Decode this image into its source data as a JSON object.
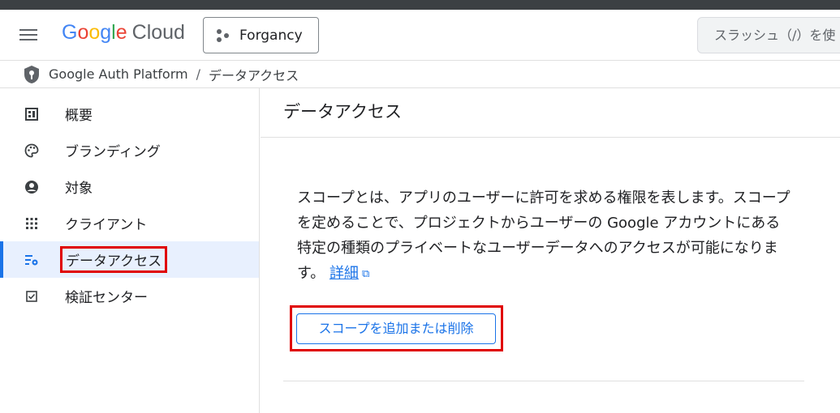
{
  "header": {
    "logo_google_letters": [
      "G",
      "o",
      "o",
      "g",
      "l",
      "e"
    ],
    "logo_cloud": "Cloud",
    "project_name": "Forgancy",
    "search_placeholder": "スラッシュ（/）を使"
  },
  "breadcrumb": {
    "root": "Google Auth Platform",
    "separator": "/",
    "current": "データアクセス"
  },
  "sidebar": {
    "items": [
      {
        "label": "概要",
        "icon": "dashboard-icon"
      },
      {
        "label": "ブランディング",
        "icon": "palette-icon"
      },
      {
        "label": "対象",
        "icon": "account-circle-icon"
      },
      {
        "label": "クライアント",
        "icon": "apps-grid-icon"
      },
      {
        "label": "データアクセス",
        "icon": "data-settings-icon",
        "active": true
      },
      {
        "label": "検証センター",
        "icon": "checkbox-icon"
      }
    ]
  },
  "main": {
    "title": "データアクセス",
    "description": "スコープとは、アプリのユーザーに許可を求める権限を表します。スコープを定めることで、プロジェクトからユーザーの Google アカウントにある特定の種類のプライベートなユーザーデータへのアクセスが可能になります。",
    "details_link": "詳細",
    "scope_button": "スコープを追加または削除"
  },
  "colors": {
    "accent": "#1a73e8",
    "highlight_box": "#e00000",
    "active_bg": "#e8f0fe"
  }
}
